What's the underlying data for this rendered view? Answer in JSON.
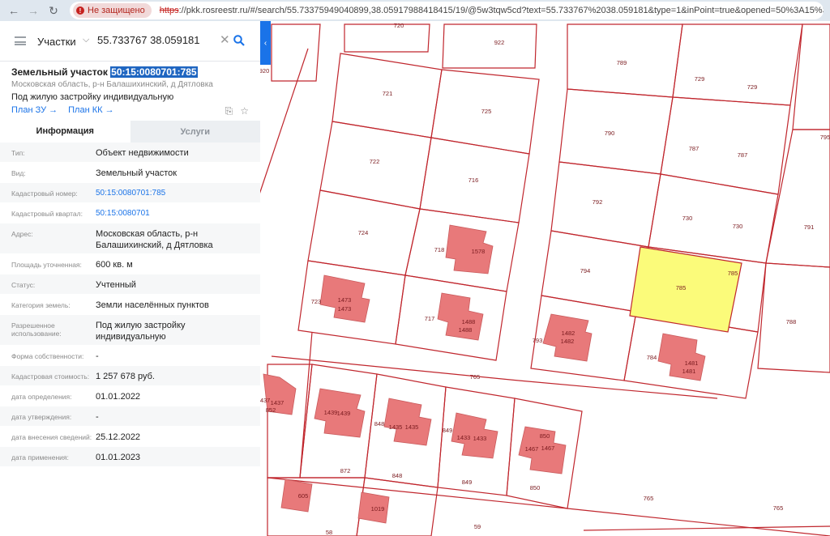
{
  "browser": {
    "security_label": "Не защищено",
    "url_scheme": "https",
    "url_rest": "://pkk.rosreestr.ru/#/search/55.73375949040899,38.05917988418415/19/@5w3tqw5cd?text=55.733767%2038.059181&type=1&inPoint=true&opened=50%3A15%3A80701%3A785"
  },
  "search": {
    "type_label": "Участки",
    "query": "55.733767 38.059181"
  },
  "object": {
    "title_prefix": "Земельный участок ",
    "cadastral_number": "50:15:0080701:785",
    "address": "Московская область, р-н Балашихинский, д Дятловка",
    "use": "Под жилую застройку индивидуальную",
    "link_plan_zu": "План ЗУ →",
    "link_plan_kk": "План КК →"
  },
  "tabs": {
    "info": "Информация",
    "services": "Услуги"
  },
  "info_rows": [
    {
      "k": "Тип:",
      "v": "Объект недвижимости"
    },
    {
      "k": "Вид:",
      "v": "Земельный участок"
    },
    {
      "k": "Кадастровый номер:",
      "v": "50:15:0080701:785"
    },
    {
      "k": "Кадастровый квартал:",
      "v": "50:15:0080701"
    },
    {
      "k": "Адрес:",
      "v": "Московская область, р-н Балашихинский, д Дятловка"
    },
    {
      "k": "Площадь уточненная:",
      "v": "600 кв. м"
    },
    {
      "k": "Статус:",
      "v": "Учтенный"
    },
    {
      "k": "Категория земель:",
      "v": "Земли населённых пунктов"
    },
    {
      "k": "Разрешенное использование:",
      "v": "Под жилую застройку индивидуальную"
    },
    {
      "k": "Форма собственности:",
      "v": "-"
    },
    {
      "k": "Кадастровая стоимость:",
      "v": "1 257 678 руб."
    },
    {
      "k": "дата определения:",
      "v": "01.01.2022"
    },
    {
      "k": "дата утверждения:",
      "v": "-"
    },
    {
      "k": "дата внесения сведений:",
      "v": "25.12.2022"
    },
    {
      "k": "дата применения:",
      "v": "01.01.2023"
    }
  ],
  "map": {
    "parcel_labels": [
      "720",
      "922",
      "920",
      "721",
      "725",
      "789",
      "729",
      "729",
      "795",
      "790",
      "787",
      "787",
      "722",
      "716",
      "792",
      "730",
      "791",
      "730",
      "724",
      "718",
      "1578",
      "794",
      "785",
      "785",
      "788",
      "723",
      "1473",
      "1473",
      "717",
      "1488",
      "1488",
      "793",
      "1482",
      "1482",
      "784",
      "1481",
      "1481",
      "765",
      "1437",
      "1437",
      "852",
      "1439",
      "1439",
      "848",
      "1435",
      "1435",
      "849",
      "1433",
      "1433",
      "850",
      "1467",
      "1467",
      "872",
      "848",
      "849",
      "850",
      "605",
      "1019",
      "765",
      "765",
      "58",
      "59"
    ],
    "colors": {
      "boundary": "#c0262d",
      "building": "#e8797a",
      "selected": "#fbfb7a"
    }
  }
}
